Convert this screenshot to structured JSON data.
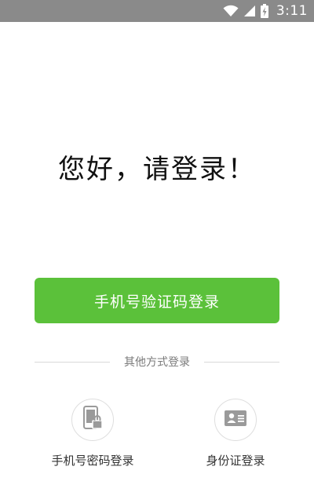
{
  "status_bar": {
    "time": "3:11",
    "icons": [
      "wifi-icon",
      "signal-icon",
      "battery-charging-icon"
    ]
  },
  "greeting": "您好，请登录！",
  "primary_button": {
    "label": "手机号验证码登录",
    "color": "#5bc13a"
  },
  "divider_label": "其他方式登录",
  "options": [
    {
      "label": "手机号密码登录",
      "icon": "phone-lock-icon"
    },
    {
      "label": "身份证登录",
      "icon": "id-card-icon"
    }
  ]
}
